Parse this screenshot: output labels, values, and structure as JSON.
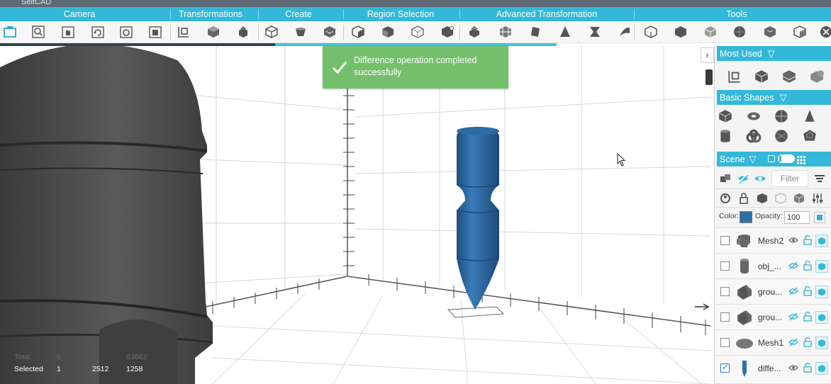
{
  "app": {
    "title_fragment": "SelfCAD"
  },
  "menu": {
    "groups": [
      {
        "label": "Camera"
      },
      {
        "label": "Transformations"
      },
      {
        "label": "Create"
      },
      {
        "label": "Region Selection"
      },
      {
        "label": "Advanced Transformation"
      },
      {
        "label": "Tools"
      }
    ]
  },
  "toolbar": {
    "tools": [
      "select-tool-icon",
      "zoom-select-icon",
      "pan-icon",
      "rotate-view-icon",
      "fit-view-icon",
      "reset-view-icon",
      "move-icon",
      "rotate-object-icon",
      "scale-icon",
      "create-cube-icon",
      "create-cylinder-icon",
      "create-sphere-icon",
      "region-select-icon",
      "face-select-icon",
      "edge-select-icon",
      "vertex-select-icon",
      "extrude-icon",
      "bevel-icon",
      "loft-icon",
      "pyramid-icon",
      "twist-icon",
      "bend-icon",
      "union-icon",
      "difference-icon",
      "intersection-icon",
      "sphere-tool-icon",
      "shell-icon",
      "mirror-icon",
      "more-tools-icon"
    ]
  },
  "notification": {
    "message": "Difference operation completed successfully",
    "color": "#74bf6c"
  },
  "stats": {
    "headers": [
      "Total",
      "6",
      "",
      "63662"
    ],
    "selected": {
      "label": "Selected",
      "objects": "1",
      "vertices": "2512",
      "faces": "1258"
    }
  },
  "panel": {
    "most_used": {
      "title": "Most Used",
      "icons": [
        "move-tool-icon",
        "cube-tool-icon",
        "union-tool-icon",
        "difference-tool-icon"
      ]
    },
    "basic_shapes": {
      "title": "Basic Shapes",
      "icons": [
        "cube-shape-icon",
        "torus-shape-icon",
        "sphere-shape-icon",
        "cone-shape-icon",
        "cylinder-shape-icon",
        "knot-shape-icon",
        "geosphere-shape-icon",
        "dodecahedron-shape-icon"
      ]
    },
    "scene": {
      "title": "Scene",
      "filter_label": "Filter",
      "color_label": "Color:",
      "color_value": "#2f6fa8",
      "opacity_label": "Opacity:",
      "opacity_value": "100",
      "objects": [
        {
          "name": "Mesh2",
          "checked": false,
          "thumb": "mesh-thumb"
        },
        {
          "name": "obj_...",
          "checked": false,
          "thumb": "cylinder-thumb"
        },
        {
          "name": "grou...",
          "checked": false,
          "thumb": "group-thumb"
        },
        {
          "name": "grou...",
          "checked": false,
          "thumb": "group-thumb"
        },
        {
          "name": "Mesh1",
          "checked": false,
          "thumb": "disc-thumb"
        },
        {
          "name": "diffe...",
          "checked": true,
          "thumb": "difference-thumb"
        }
      ]
    }
  },
  "colors": {
    "accent": "#34b8da",
    "model_blue": "#2f6fa8",
    "model_dark": "#4a4a4a"
  }
}
